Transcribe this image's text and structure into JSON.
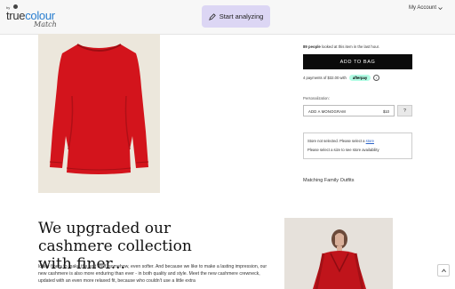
{
  "header": {
    "logo_by": "by",
    "logo_brand_main": "true",
    "logo_brand_sub": "colour",
    "logo_script": "Match",
    "analyze_label": "Start analyzing",
    "account_label": "My Account"
  },
  "product": {
    "views_count": "89 people",
    "views_text": " looked at this item in the last hour.",
    "add_to_bag_label": "ADD TO BAG",
    "afterpay_text": "4 payments of $32.00 with",
    "afterpay_badge": "afterpay",
    "afterpay_info": "i",
    "personalization_label": "Personalization:",
    "monogram_label": "ADD A MONOGRAM",
    "monogram_price": "$10",
    "help_label": "?",
    "store_line1": "Store not selected. Please select a ",
    "store_link": "store",
    "store_line2": "Please select a size to see store availability",
    "matching_label": "Matching Family Outfits"
  },
  "content": {
    "heading": "We upgraded our cashmere collection with finer...",
    "body": "loftier fibers to make the soft stuff, somehow, even softer. And because we like to make a lasting impression, our new cashmere is also more enduring than ever - in both quality and style. Meet the new cashmere crewneck, updated with an even more relaxed fit, because who couldn't use a little extra"
  },
  "colors": {
    "accent_purple": "#dcd6f4",
    "garment_red": "#d3141c",
    "afterpay_mint": "#b2fce4",
    "link_blue": "#2a62c8"
  },
  "icons": {
    "analyze": "pen-icon",
    "account": "chevron-down-icon",
    "scroll": "chevron-up-icon"
  }
}
